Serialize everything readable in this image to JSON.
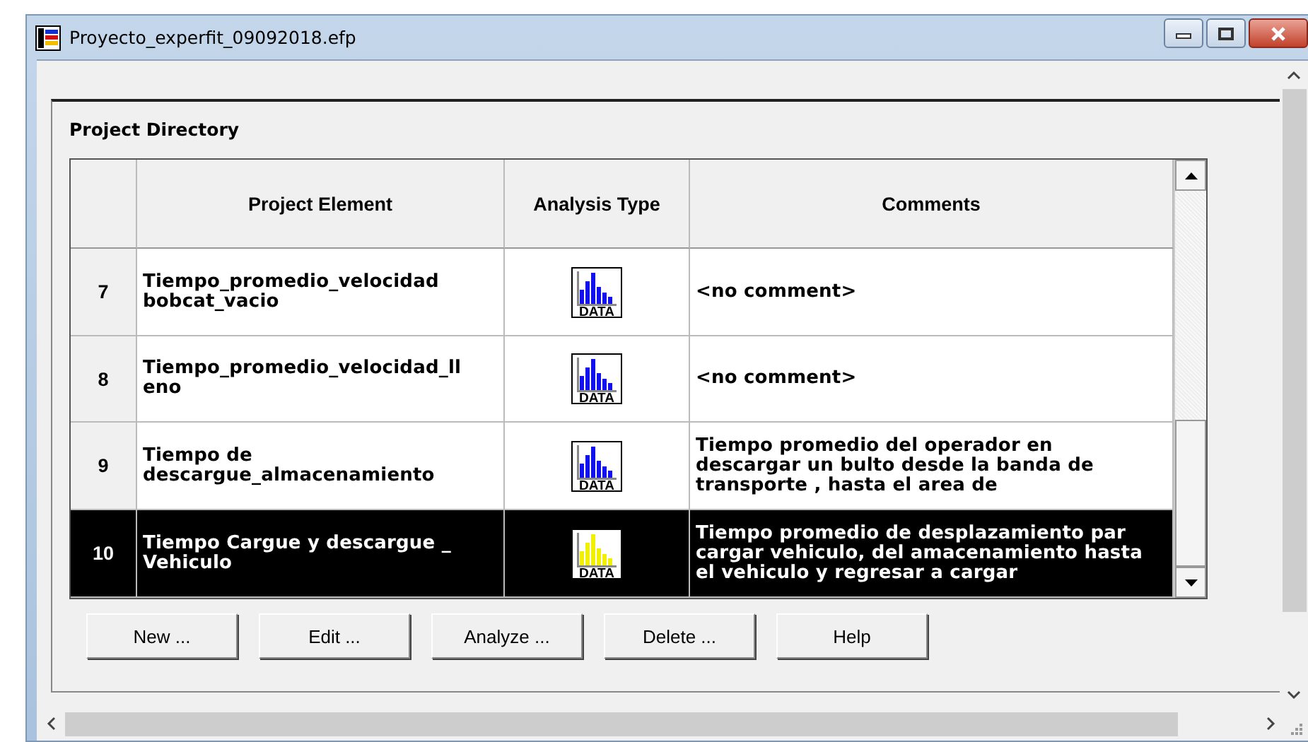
{
  "window": {
    "title": "Proyecto_experfit_09092018.efp"
  },
  "panel": {
    "title": "Project Directory"
  },
  "table": {
    "columns": [
      "Project Element",
      "Analysis Type",
      "Comments"
    ],
    "rows": [
      {
        "number": "7",
        "element": "Tiempo_promedio_velocidad bobcat_vacio",
        "analysis": "DATA",
        "comment": "<no comment>",
        "selected": false
      },
      {
        "number": "8",
        "element": "Tiempo_promedio_velocidad_ll eno",
        "analysis": "DATA",
        "comment": "<no comment>",
        "selected": false
      },
      {
        "number": "9",
        "element": "Tiempo de descargue_almacenamiento",
        "analysis": "DATA",
        "comment": "Tiempo promedio del operador en descargar un bulto desde la banda  de transporte , hasta el area de",
        "selected": false
      },
      {
        "number": "10",
        "element": "Tiempo Cargue y descargue _ Vehiculo",
        "analysis": "DATA",
        "comment": "Tiempo promedio de desplazamiento par cargar vehiculo, del amacenamiento hasta el vehiculo y regresar a cargar",
        "selected": true
      }
    ]
  },
  "buttons": [
    "New ...",
    "Edit ...",
    "Analyze ...",
    "Delete ...",
    "Help"
  ]
}
